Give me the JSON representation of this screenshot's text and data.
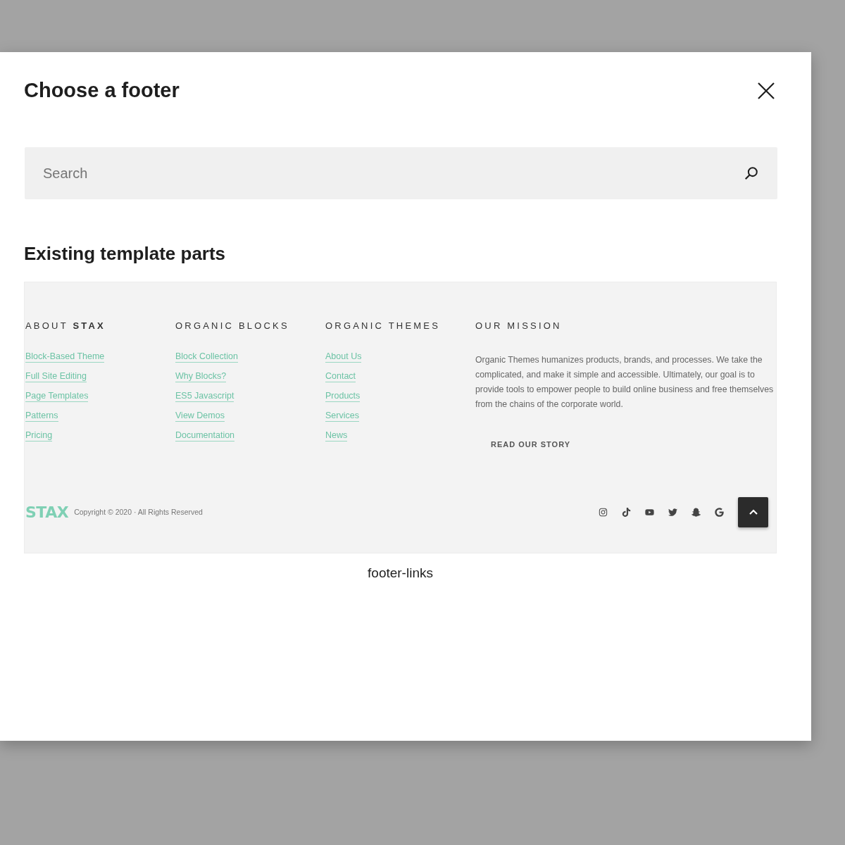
{
  "dialog": {
    "title": "Choose a footer"
  },
  "search": {
    "placeholder": "Search"
  },
  "section_title": "Existing template parts",
  "template_parts": [
    {
      "name": "footer-links",
      "preview": {
        "columns": [
          {
            "heading": "ABOUT **STAX**",
            "links": [
              "Block-Based Theme",
              "Full Site Editing",
              "Page Templates",
              "Patterns",
              "Pricing"
            ]
          },
          {
            "heading": "ORGANIC BLOCKS",
            "links": [
              "Block Collection",
              "Why Blocks?",
              "ES5 Javascript",
              "View Demos",
              "Documentation"
            ]
          },
          {
            "heading": "ORGANIC THEMES",
            "links": [
              "About Us",
              "Contact",
              "Products",
              "Services",
              "News"
            ]
          }
        ],
        "mission": {
          "heading": "OUR MISSION",
          "text": "Organic Themes humanizes products, brands, and processes. We take the complicated, and make it simple and accessible. Ultimately, our goal is to provide tools to empower people to build online business and free themselves from the chains of the corporate world.",
          "button": "READ OUR STORY"
        },
        "logo": "STAX",
        "copyright": "Copyright © 2020 · All Rights Reserved"
      }
    }
  ]
}
